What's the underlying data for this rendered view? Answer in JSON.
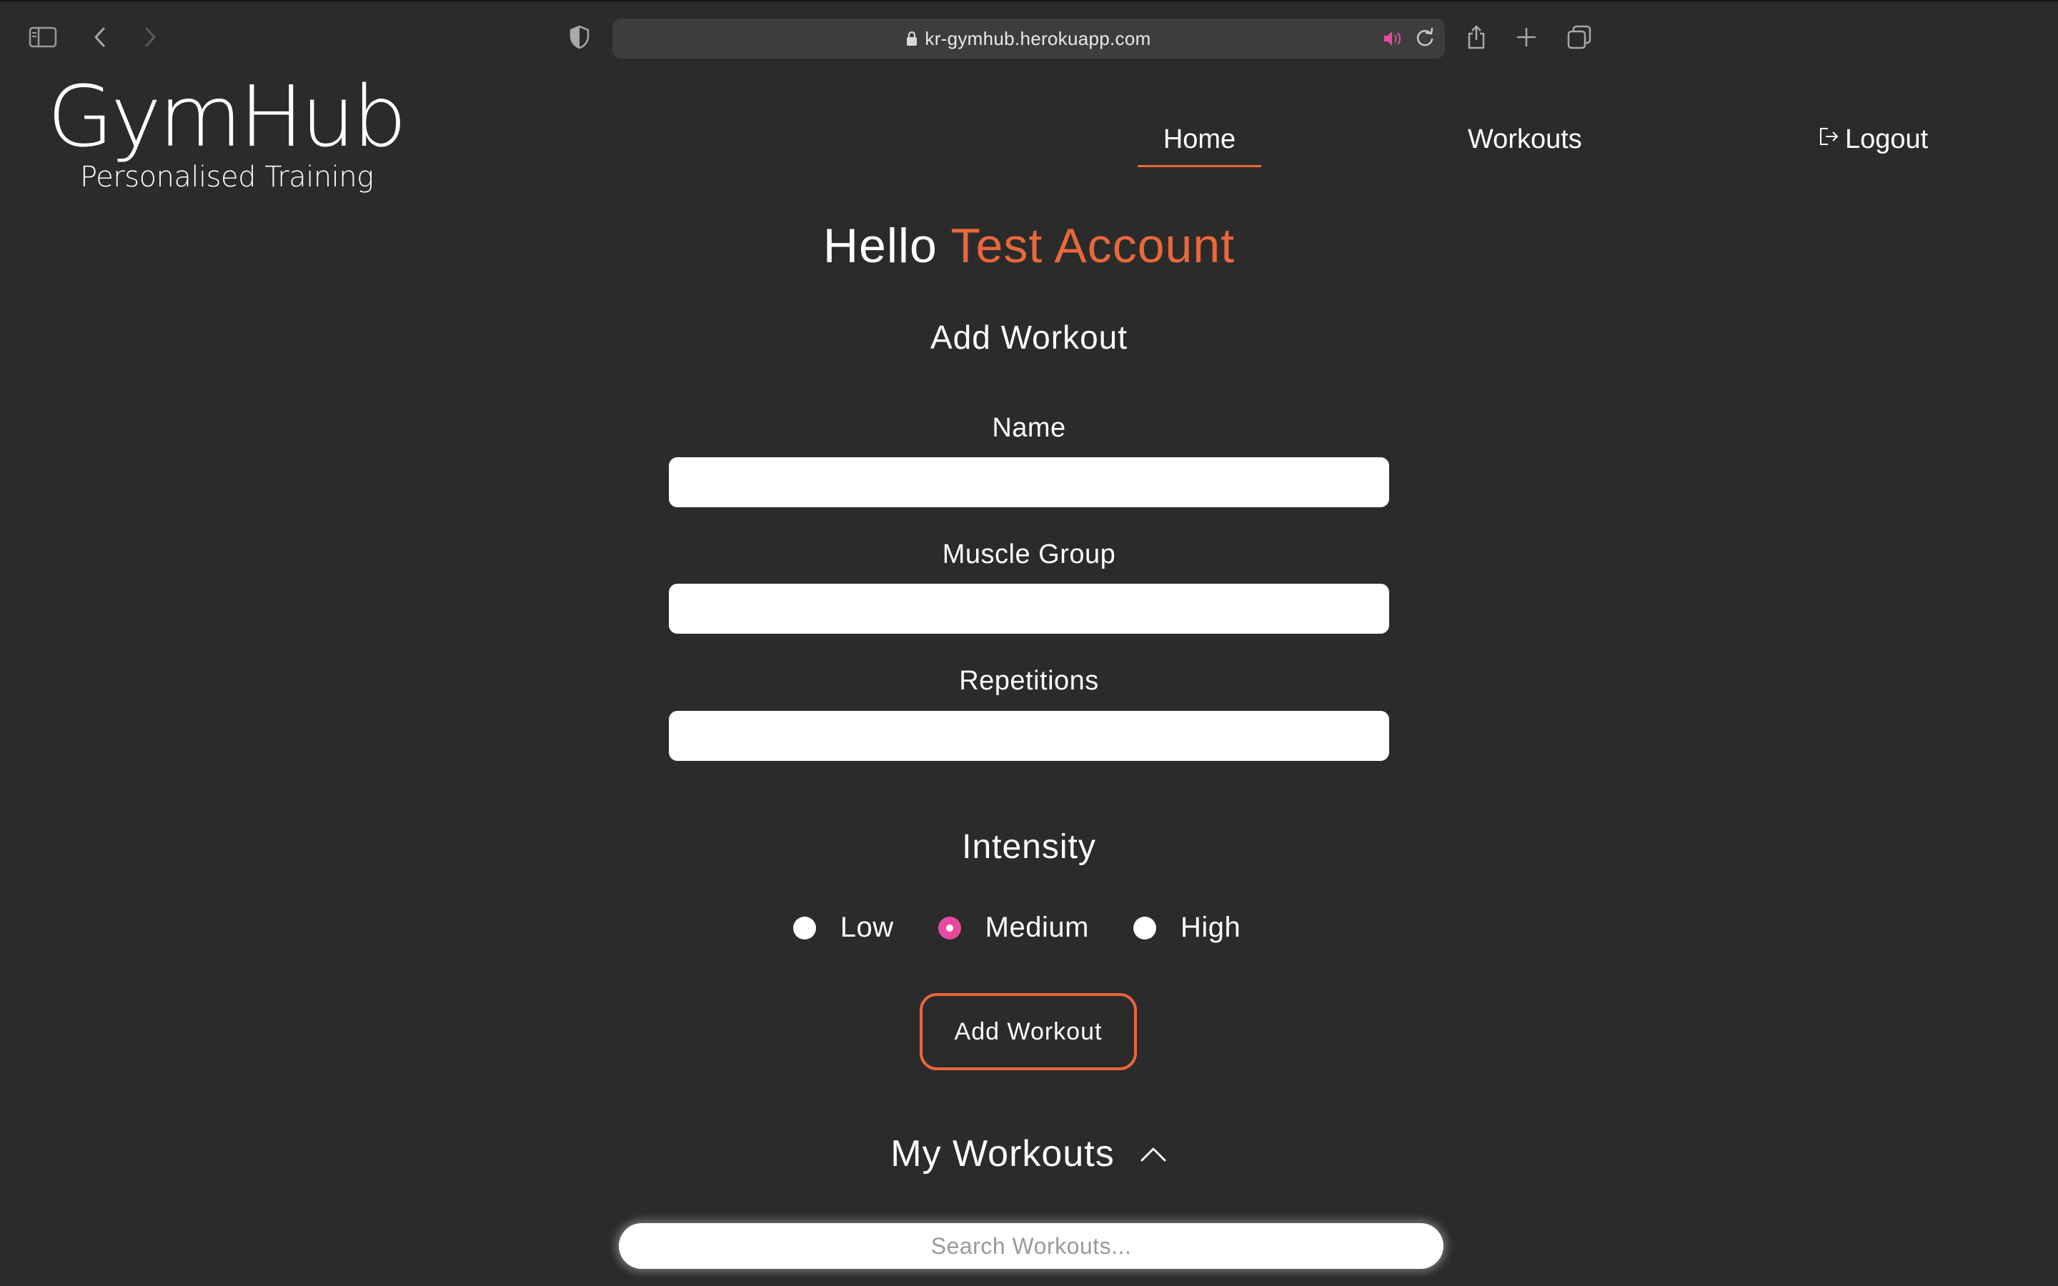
{
  "browser": {
    "url": "kr-gymhub.herokuapp.com",
    "icons": [
      "sidebar-icon",
      "back-icon",
      "forward-icon",
      "privacy-shield-icon",
      "lock-icon",
      "audio-icon",
      "reload-icon",
      "share-icon",
      "new-tab-icon",
      "tabs-overview-icon"
    ]
  },
  "brand": {
    "title": "GymHub",
    "subtitle": "Personalised Training"
  },
  "nav": {
    "home": "Home",
    "workouts": "Workouts",
    "logout": "Logout",
    "active": "Home"
  },
  "greeting": {
    "prefix": "Hello",
    "user": "Test Account"
  },
  "form": {
    "title": "Add Workout",
    "name_label": "Name",
    "name_value": "",
    "muscle_label": "Muscle Group",
    "muscle_value": "",
    "reps_label": "Repetitions",
    "reps_value": "",
    "intensity_label": "Intensity",
    "intensity_options": [
      "Low",
      "Medium",
      "High"
    ],
    "intensity_selected": "Medium",
    "submit_label": "Add Workout"
  },
  "workouts": {
    "title": "My Workouts",
    "search_placeholder": "Search Workouts..."
  },
  "colors": {
    "background": "#2b2b2b",
    "accent": "#e8673b",
    "radio_checked": "#e84aa1",
    "text": "#ffffff"
  }
}
